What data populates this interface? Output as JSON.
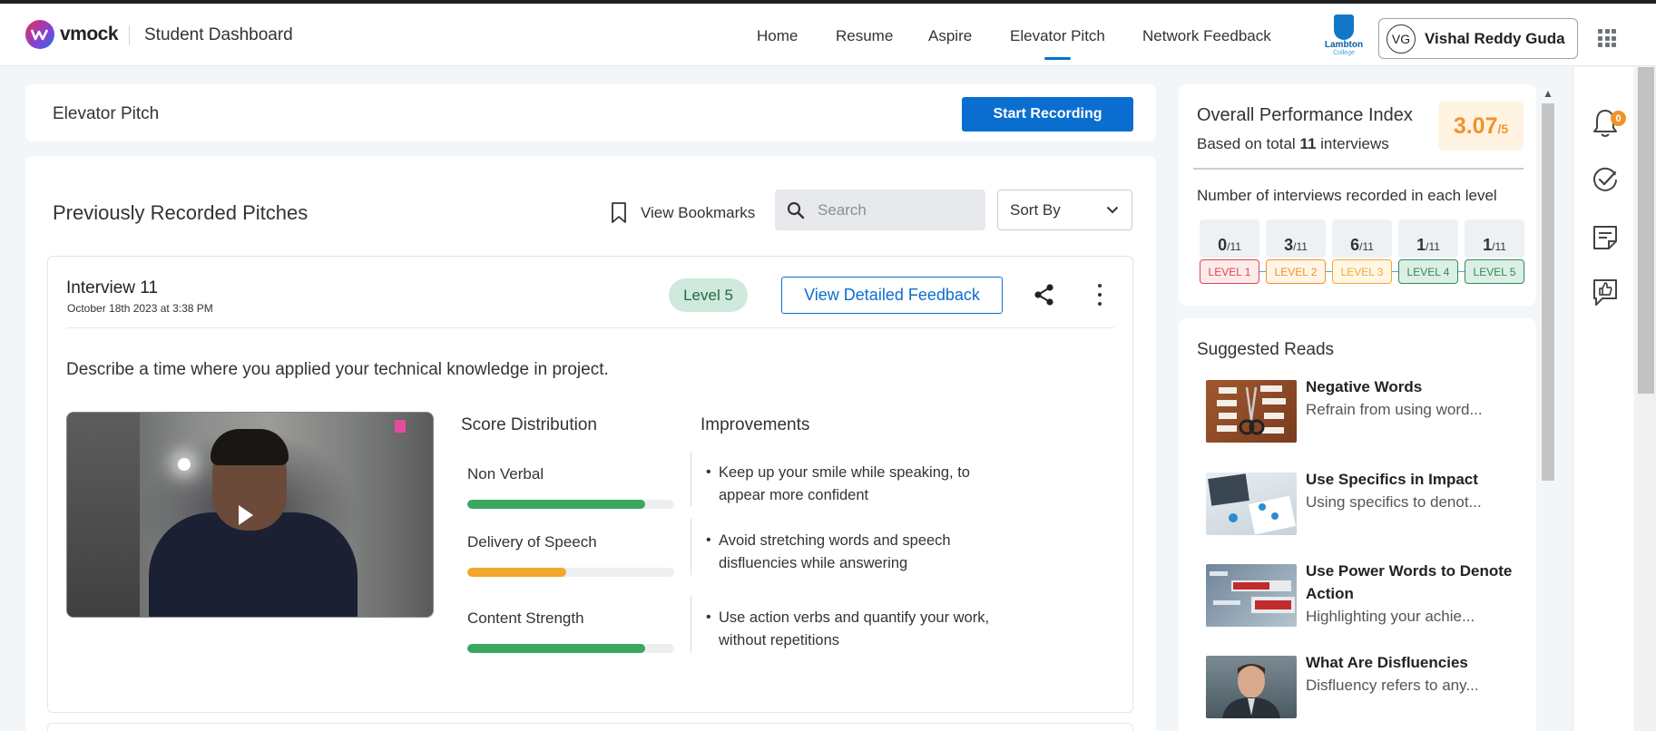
{
  "brand": {
    "name": "vmock",
    "section": "Student Dashboard"
  },
  "nav": {
    "items": [
      "Home",
      "Resume",
      "Aspire",
      "Elevator Pitch",
      "Network Feedback"
    ],
    "active": "Elevator Pitch"
  },
  "institution": {
    "line1": "Lambton",
    "line2": "College"
  },
  "user": {
    "initials": "VG",
    "name": "Vishal Reddy Guda"
  },
  "page": {
    "title": "Elevator Pitch",
    "start_recording_label": "Start Recording"
  },
  "pitches": {
    "title": "Previously Recorded Pitches",
    "bookmarks_label": "View Bookmarks",
    "search_placeholder": "Search",
    "sort_label": "Sort By"
  },
  "interview": {
    "title": "Interview 11",
    "date": "October 18th 2023 at 3:38 PM",
    "level": "Level 5",
    "feedback_label": "View Detailed Feedback",
    "question": "Describe a time where you applied your technical knowledge in project.",
    "score_distribution_title": "Score Distribution",
    "improvements_title": "Improvements",
    "metrics": [
      {
        "label": "Non Verbal",
        "fraction": 0.86,
        "color": "#3aa660",
        "improvement": "Keep up your smile while speaking, to appear more confident"
      },
      {
        "label": "Delivery of Speech",
        "fraction": 0.48,
        "color": "#f3a62c",
        "improvement": "Avoid stretching words and speech disfluencies while answering"
      },
      {
        "label": "Content Strength",
        "fraction": 0.86,
        "color": "#3aa660",
        "improvement": "Use action verbs and quantify your work, without repetitions"
      }
    ]
  },
  "performance": {
    "title": "Overall Performance Index",
    "subtitle_prefix": "Based on total",
    "interview_count": "11",
    "subtitle_suffix": "interviews",
    "score": "3.07",
    "score_max": "/5",
    "levels_title": "Number of interviews recorded in each level",
    "levels": [
      {
        "count": "0",
        "total": "/11",
        "label": "LEVEL 1",
        "color": "#e0454a",
        "bg": "#fdeaea"
      },
      {
        "count": "3",
        "total": "/11",
        "label": "LEVEL 2",
        "color": "#f0932b",
        "bg": "#fff4e6"
      },
      {
        "count": "6",
        "total": "/11",
        "label": "LEVEL 3",
        "color": "#f0a93b",
        "bg": "#fff6e4"
      },
      {
        "count": "1",
        "total": "/11",
        "label": "LEVEL 4",
        "color": "#2f8a57",
        "bg": "#dcefe4"
      },
      {
        "count": "1",
        "total": "/11",
        "label": "LEVEL 5",
        "color": "#2f8a57",
        "bg": "#dcefe4"
      }
    ]
  },
  "suggested_reads": {
    "title": "Suggested Reads",
    "items": [
      {
        "title": "Negative Words",
        "desc": "Refrain from using word..."
      },
      {
        "title": "Use Specifics in Impact",
        "desc": "Using specifics to denot..."
      },
      {
        "title": "Use Power Words to Denote Action",
        "desc": "Highlighting your achie..."
      },
      {
        "title": "What Are Disfluencies",
        "desc": "Disfluency refers to any..."
      }
    ]
  },
  "notifications": {
    "count": "0"
  },
  "icons": [
    "vmock-logo-icon",
    "apps-grid-icon",
    "bookmark-icon",
    "search-icon",
    "chevron-down-icon",
    "share-icon",
    "kebab-menu-icon",
    "play-icon",
    "bell-icon",
    "check-circle-icon",
    "notes-icon",
    "thumbs-up-chat-icon"
  ]
}
